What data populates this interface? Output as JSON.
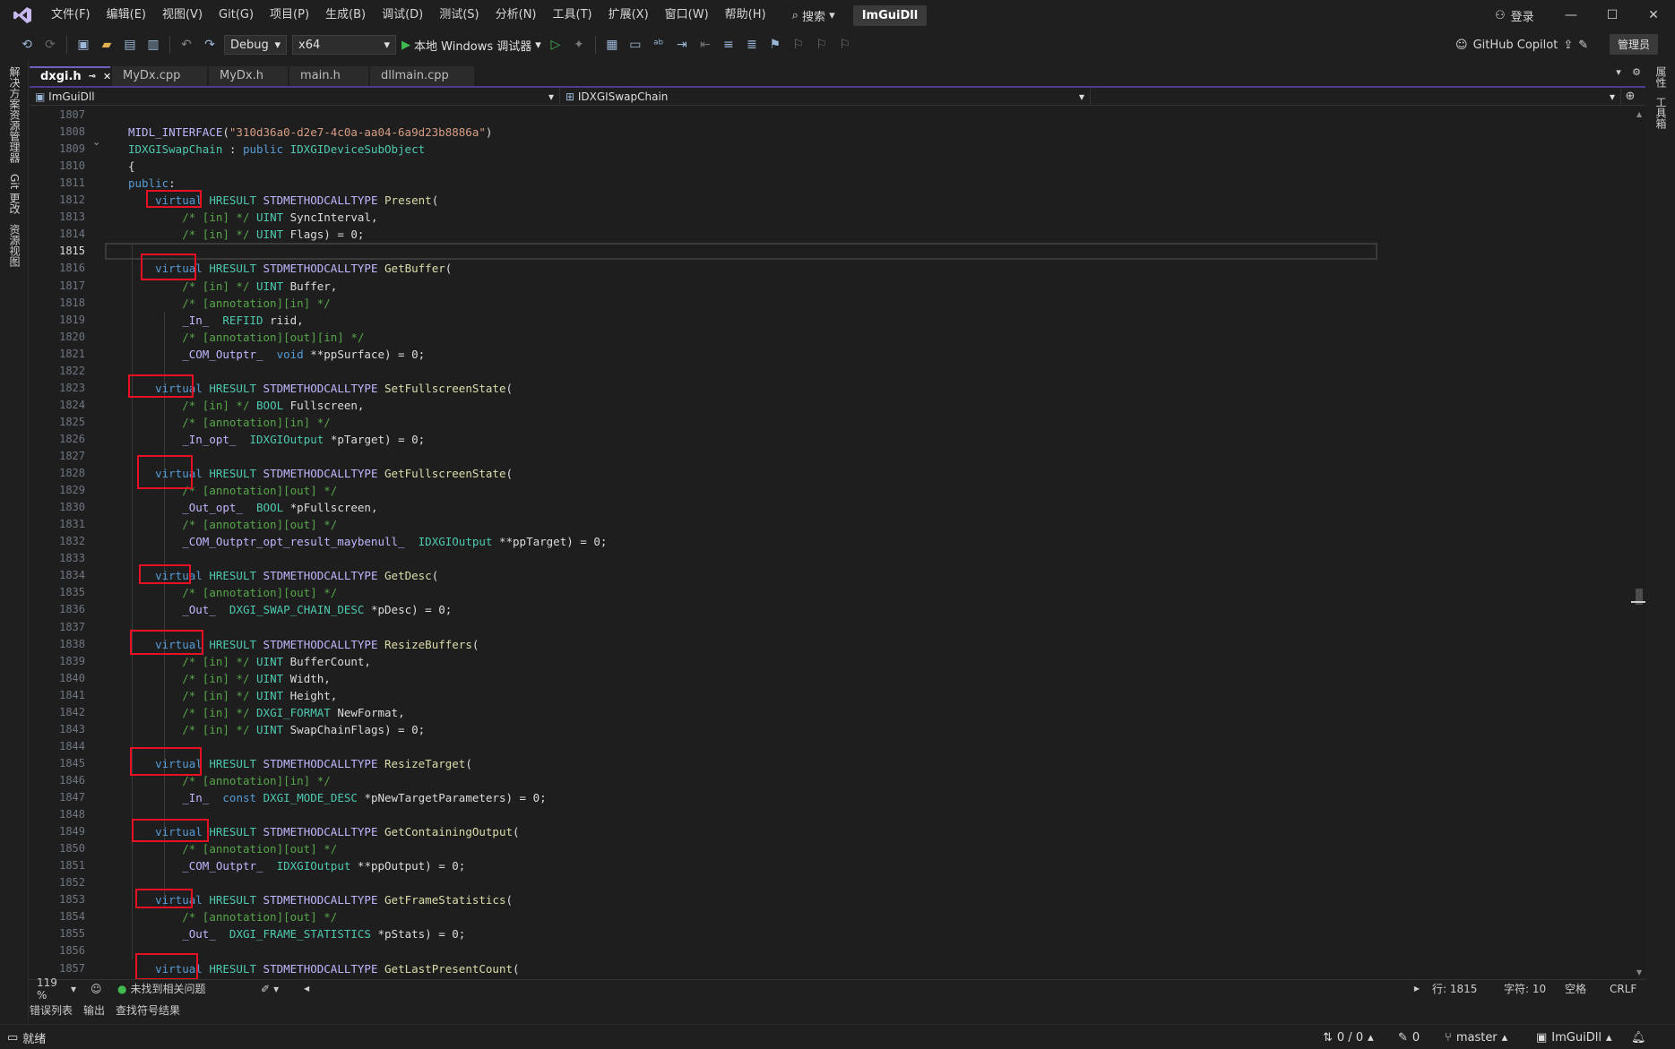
{
  "menu": {
    "items": [
      "文件(F)",
      "编辑(E)",
      "视图(V)",
      "Git(G)",
      "项目(P)",
      "生成(B)",
      "调试(D)",
      "测试(S)",
      "分析(N)",
      "工具(T)",
      "扩展(X)",
      "窗口(W)",
      "帮助(H)"
    ],
    "search_label": "搜索",
    "solution_title": "ImGuiDll",
    "login_label": "登录"
  },
  "toolbar": {
    "config": "Debug",
    "platform": "x64",
    "run_label": "本地 Windows 调试器",
    "copilot_label": "GitHub Copilot",
    "admin_label": "管理员"
  },
  "left_strip": {
    "tabs": [
      "解决方案资源管理器",
      "Git 更改",
      "资源视图"
    ]
  },
  "right_strip": {
    "tabs": [
      "属性",
      "工具箱"
    ]
  },
  "tabs": [
    {
      "label": "dxgi.h",
      "active": true,
      "pinned": true
    },
    {
      "label": "MyDx.cpp",
      "active": false
    },
    {
      "label": "MyDx.h",
      "active": false
    },
    {
      "label": "main.h",
      "active": false
    },
    {
      "label": "dllmain.cpp",
      "active": false
    }
  ],
  "navbar": {
    "project": "ImGuiDll",
    "scope": "IDXGISwapChain",
    "member": ""
  },
  "editor": {
    "current_line": "1815",
    "line_numbers": [
      "1807",
      "1808",
      "1809",
      "1810",
      "1811",
      "1812",
      "1813",
      "1814",
      "1815",
      "1816",
      "1817",
      "1818",
      "1819",
      "1820",
      "1821",
      "1822",
      "1823",
      "1824",
      "1825",
      "1826",
      "1827",
      "1828",
      "1829",
      "1830",
      "1831",
      "1832",
      "1833",
      "1834",
      "1835",
      "1836",
      "1837",
      "1838",
      "1839",
      "1840",
      "1841",
      "1842",
      "1843",
      "1844",
      "1845",
      "1846",
      "1847",
      "1848",
      "1849",
      "1850",
      "1851",
      "1852",
      "1853",
      "1854",
      "1855",
      "1856",
      "1857"
    ],
    "lines": [
      [],
      [
        [
          "mc",
          "MIDL_INTERFACE"
        ],
        [
          "plain",
          "("
        ],
        [
          "str",
          "\"310d36a0-d2e7-4c0a-aa04-6a9d23b8886a\""
        ],
        [
          "plain",
          ")"
        ]
      ],
      [
        [
          "ty",
          "IDXGISwapChain"
        ],
        [
          "plain",
          " : "
        ],
        [
          "kw",
          "public"
        ],
        [
          "plain",
          " "
        ],
        [
          "ty",
          "IDXGIDeviceSubObject"
        ]
      ],
      [
        [
          "plain",
          "{"
        ]
      ],
      [
        [
          "kw",
          "public"
        ],
        [
          "plain",
          ":"
        ]
      ],
      [
        [
          "plain",
          "    "
        ],
        [
          "kw",
          "virtual"
        ],
        [
          "plain",
          " "
        ],
        [
          "ty",
          "HRESULT"
        ],
        [
          "plain",
          " "
        ],
        [
          "mc",
          "STDMETHODCALLTYPE"
        ],
        [
          "plain",
          " "
        ],
        [
          "fn",
          "Present"
        ],
        [
          "plain",
          "("
        ]
      ],
      [
        [
          "plain",
          "        "
        ],
        [
          "cm",
          "/* [in] */"
        ],
        [
          "plain",
          " "
        ],
        [
          "ty",
          "UINT"
        ],
        [
          "plain",
          " SyncInterval,"
        ]
      ],
      [
        [
          "plain",
          "        "
        ],
        [
          "cm",
          "/* [in] */"
        ],
        [
          "plain",
          " "
        ],
        [
          "ty",
          "UINT"
        ],
        [
          "plain",
          " Flags) = 0;"
        ]
      ],
      [],
      [
        [
          "plain",
          "    "
        ],
        [
          "kw",
          "virtual"
        ],
        [
          "plain",
          " "
        ],
        [
          "ty",
          "HRESULT"
        ],
        [
          "plain",
          " "
        ],
        [
          "mc",
          "STDMETHODCALLTYPE"
        ],
        [
          "plain",
          " "
        ],
        [
          "fn",
          "GetBuffer"
        ],
        [
          "plain",
          "("
        ]
      ],
      [
        [
          "plain",
          "        "
        ],
        [
          "cm",
          "/* [in] */"
        ],
        [
          "plain",
          " "
        ],
        [
          "ty",
          "UINT"
        ],
        [
          "plain",
          " Buffer,"
        ]
      ],
      [
        [
          "plain",
          "        "
        ],
        [
          "cm",
          "/* [annotation][in] */"
        ]
      ],
      [
        [
          "plain",
          "        "
        ],
        [
          "mc",
          "_In_"
        ],
        [
          "plain",
          "  "
        ],
        [
          "ty",
          "REFIID"
        ],
        [
          "plain",
          " riid,"
        ]
      ],
      [
        [
          "plain",
          "        "
        ],
        [
          "cm",
          "/* [annotation][out][in] */"
        ]
      ],
      [
        [
          "plain",
          "        "
        ],
        [
          "mc",
          "_COM_Outptr_"
        ],
        [
          "plain",
          "  "
        ],
        [
          "kw",
          "void"
        ],
        [
          "plain",
          " **ppSurface) = 0;"
        ]
      ],
      [],
      [
        [
          "plain",
          "    "
        ],
        [
          "kw",
          "virtual"
        ],
        [
          "plain",
          " "
        ],
        [
          "ty",
          "HRESULT"
        ],
        [
          "plain",
          " "
        ],
        [
          "mc",
          "STDMETHODCALLTYPE"
        ],
        [
          "plain",
          " "
        ],
        [
          "fn",
          "SetFullscreenState"
        ],
        [
          "plain",
          "("
        ]
      ],
      [
        [
          "plain",
          "        "
        ],
        [
          "cm",
          "/* [in] */"
        ],
        [
          "plain",
          " "
        ],
        [
          "ty",
          "BOOL"
        ],
        [
          "plain",
          " Fullscreen,"
        ]
      ],
      [
        [
          "plain",
          "        "
        ],
        [
          "cm",
          "/* [annotation][in] */"
        ]
      ],
      [
        [
          "plain",
          "        "
        ],
        [
          "mc",
          "_In_opt_"
        ],
        [
          "plain",
          "  "
        ],
        [
          "ty",
          "IDXGIOutput"
        ],
        [
          "plain",
          " *pTarget) = 0;"
        ]
      ],
      [],
      [
        [
          "plain",
          "    "
        ],
        [
          "kw",
          "virtual"
        ],
        [
          "plain",
          " "
        ],
        [
          "ty",
          "HRESULT"
        ],
        [
          "plain",
          " "
        ],
        [
          "mc",
          "STDMETHODCALLTYPE"
        ],
        [
          "plain",
          " "
        ],
        [
          "fn",
          "GetFullscreenState"
        ],
        [
          "plain",
          "("
        ]
      ],
      [
        [
          "plain",
          "        "
        ],
        [
          "cm",
          "/* [annotation][out] */"
        ]
      ],
      [
        [
          "plain",
          "        "
        ],
        [
          "mc",
          "_Out_opt_"
        ],
        [
          "plain",
          "  "
        ],
        [
          "ty",
          "BOOL"
        ],
        [
          "plain",
          " *pFullscreen,"
        ]
      ],
      [
        [
          "plain",
          "        "
        ],
        [
          "cm",
          "/* [annotation][out] */"
        ]
      ],
      [
        [
          "plain",
          "        "
        ],
        [
          "mc",
          "_COM_Outptr_opt_result_maybenull_"
        ],
        [
          "plain",
          "  "
        ],
        [
          "ty",
          "IDXGIOutput"
        ],
        [
          "plain",
          " **ppTarget) = 0;"
        ]
      ],
      [],
      [
        [
          "plain",
          "    "
        ],
        [
          "kw",
          "virtual"
        ],
        [
          "plain",
          " "
        ],
        [
          "ty",
          "HRESULT"
        ],
        [
          "plain",
          " "
        ],
        [
          "mc",
          "STDMETHODCALLTYPE"
        ],
        [
          "plain",
          " "
        ],
        [
          "fn",
          "GetDesc"
        ],
        [
          "plain",
          "("
        ]
      ],
      [
        [
          "plain",
          "        "
        ],
        [
          "cm",
          "/* [annotation][out] */"
        ]
      ],
      [
        [
          "plain",
          "        "
        ],
        [
          "mc",
          "_Out_"
        ],
        [
          "plain",
          "  "
        ],
        [
          "ty",
          "DXGI_SWAP_CHAIN_DESC"
        ],
        [
          "plain",
          " *pDesc) = 0;"
        ]
      ],
      [],
      [
        [
          "plain",
          "    "
        ],
        [
          "kw",
          "virtual"
        ],
        [
          "plain",
          " "
        ],
        [
          "ty",
          "HRESULT"
        ],
        [
          "plain",
          " "
        ],
        [
          "mc",
          "STDMETHODCALLTYPE"
        ],
        [
          "plain",
          " "
        ],
        [
          "fn",
          "ResizeBuffers"
        ],
        [
          "plain",
          "("
        ]
      ],
      [
        [
          "plain",
          "        "
        ],
        [
          "cm",
          "/* [in] */"
        ],
        [
          "plain",
          " "
        ],
        [
          "ty",
          "UINT"
        ],
        [
          "plain",
          " BufferCount,"
        ]
      ],
      [
        [
          "plain",
          "        "
        ],
        [
          "cm",
          "/* [in] */"
        ],
        [
          "plain",
          " "
        ],
        [
          "ty",
          "UINT"
        ],
        [
          "plain",
          " Width,"
        ]
      ],
      [
        [
          "plain",
          "        "
        ],
        [
          "cm",
          "/* [in] */"
        ],
        [
          "plain",
          " "
        ],
        [
          "ty",
          "UINT"
        ],
        [
          "plain",
          " Height,"
        ]
      ],
      [
        [
          "plain",
          "        "
        ],
        [
          "cm",
          "/* [in] */"
        ],
        [
          "plain",
          " "
        ],
        [
          "ty",
          "DXGI_FORMAT"
        ],
        [
          "plain",
          " NewFormat,"
        ]
      ],
      [
        [
          "plain",
          "        "
        ],
        [
          "cm",
          "/* [in] */"
        ],
        [
          "plain",
          " "
        ],
        [
          "ty",
          "UINT"
        ],
        [
          "plain",
          " SwapChainFlags) = 0;"
        ]
      ],
      [],
      [
        [
          "plain",
          "    "
        ],
        [
          "kw",
          "virtual"
        ],
        [
          "plain",
          " "
        ],
        [
          "ty",
          "HRESULT"
        ],
        [
          "plain",
          " "
        ],
        [
          "mc",
          "STDMETHODCALLTYPE"
        ],
        [
          "plain",
          " "
        ],
        [
          "fn",
          "ResizeTarget"
        ],
        [
          "plain",
          "("
        ]
      ],
      [
        [
          "plain",
          "        "
        ],
        [
          "cm",
          "/* [annotation][in] */"
        ]
      ],
      [
        [
          "plain",
          "        "
        ],
        [
          "mc",
          "_In_"
        ],
        [
          "plain",
          "  "
        ],
        [
          "kw",
          "const"
        ],
        [
          "plain",
          " "
        ],
        [
          "ty",
          "DXGI_MODE_DESC"
        ],
        [
          "plain",
          " *pNewTargetParameters) = 0;"
        ]
      ],
      [],
      [
        [
          "plain",
          "    "
        ],
        [
          "kw",
          "virtual"
        ],
        [
          "plain",
          " "
        ],
        [
          "ty",
          "HRESULT"
        ],
        [
          "plain",
          " "
        ],
        [
          "mc",
          "STDMETHODCALLTYPE"
        ],
        [
          "plain",
          " "
        ],
        [
          "fn",
          "GetContainingOutput"
        ],
        [
          "plain",
          "("
        ]
      ],
      [
        [
          "plain",
          "        "
        ],
        [
          "cm",
          "/* [annotation][out] */"
        ]
      ],
      [
        [
          "plain",
          "        "
        ],
        [
          "mc",
          "_COM_Outptr_"
        ],
        [
          "plain",
          "  "
        ],
        [
          "ty",
          "IDXGIOutput"
        ],
        [
          "plain",
          " **ppOutput) = 0;"
        ]
      ],
      [],
      [
        [
          "plain",
          "    "
        ],
        [
          "kw",
          "virtual"
        ],
        [
          "plain",
          " "
        ],
        [
          "ty",
          "HRESULT"
        ],
        [
          "plain",
          " "
        ],
        [
          "mc",
          "STDMETHODCALLTYPE"
        ],
        [
          "plain",
          " "
        ],
        [
          "fn",
          "GetFrameStatistics"
        ],
        [
          "plain",
          "("
        ]
      ],
      [
        [
          "plain",
          "        "
        ],
        [
          "cm",
          "/* [annotation][out] */"
        ]
      ],
      [
        [
          "plain",
          "        "
        ],
        [
          "mc",
          "_Out_"
        ],
        [
          "plain",
          "  "
        ],
        [
          "ty",
          "DXGI_FRAME_STATISTICS"
        ],
        [
          "plain",
          " *pStats) = 0;"
        ]
      ],
      [],
      [
        [
          "plain",
          "    "
        ],
        [
          "kw",
          "virtual"
        ],
        [
          "plain",
          " "
        ],
        [
          "ty",
          "HRESULT"
        ],
        [
          "plain",
          " "
        ],
        [
          "mc",
          "STDMETHODCALLTYPE"
        ],
        [
          "plain",
          " "
        ],
        [
          "fn",
          "GetLastPresentCount"
        ],
        [
          "plain",
          "("
        ]
      ]
    ]
  },
  "editor_status": {
    "zoom": "119 %",
    "issues": "未找到相关问题",
    "line": "行: 1815",
    "col": "字符: 10",
    "whitespace": "空格",
    "eol": "CRLF"
  },
  "tool_tabs": [
    "错误列表",
    "输出",
    "查找符号结果"
  ],
  "statusbar": {
    "ready": "就绪",
    "sync": "0 / 0",
    "edits": "0",
    "branch": "master",
    "repo": "ImGuiDll"
  }
}
